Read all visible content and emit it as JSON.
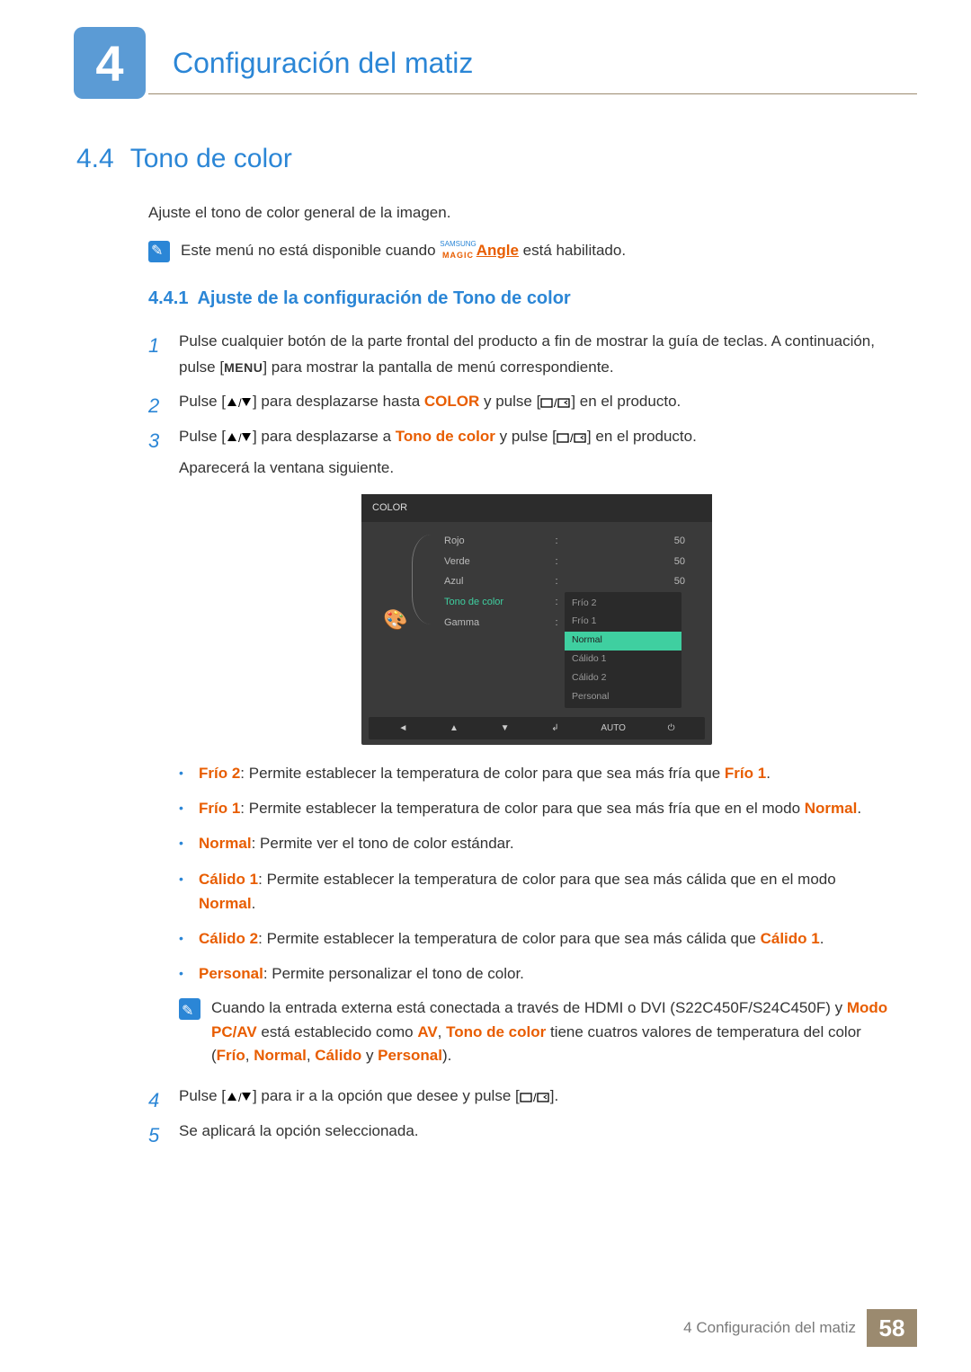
{
  "chapter": {
    "number": "4",
    "title": "Configuración del matiz"
  },
  "section": {
    "number": "4.4",
    "title": "Tono de color",
    "intro": "Ajuste el tono de color general de la imagen."
  },
  "note_top": {
    "pre": "Este menú no está disponible cuando ",
    "brand_top": "SAMSUNG",
    "brand_bottom": "MAGIC",
    "angle": "Angle",
    "post": " está habilitado."
  },
  "subsection": {
    "number": "4.4.1",
    "title": "Ajuste de la configuración de Tono de color"
  },
  "steps": {
    "s1a": "Pulse cualquier botón de la parte frontal del producto a fin de mostrar la guía de teclas. A continuación, pulse [",
    "s1_menu": "MENU",
    "s1b": "] para mostrar la pantalla de menú correspondiente.",
    "s2a": "Pulse [",
    "s2b": "] para desplazarse hasta ",
    "s2_color": "COLOR",
    "s2c": " y pulse [",
    "s2d": "] en el producto.",
    "s3a": "Pulse [",
    "s3b": "] para desplazarse a ",
    "s3_tone": "Tono de color",
    "s3c": " y pulse [",
    "s3d": "] en el producto.",
    "s3_after": "Aparecerá la ventana siguiente.",
    "s4a": "Pulse [",
    "s4b": "] para ir a la opción que desee y pulse [",
    "s4c": "].",
    "s5": "Se aplicará la opción seleccionada."
  },
  "osd": {
    "title": "COLOR",
    "rows": [
      {
        "label": "Rojo",
        "value": "50"
      },
      {
        "label": "Verde",
        "value": "50"
      },
      {
        "label": "Azul",
        "value": "50"
      },
      {
        "label": "Tono de color",
        "value": ""
      },
      {
        "label": "Gamma",
        "value": ""
      }
    ],
    "dropdown": [
      "Frío 2",
      "Frío 1",
      "Normal",
      "Cálido 1",
      "Cálido 2",
      "Personal"
    ],
    "selected": "Normal",
    "footer_auto": "AUTO"
  },
  "options": {
    "frio2_label": "Frío 2",
    "frio2_text": ": Permite establecer la temperatura de color para que sea más fría que ",
    "frio2_ref": "Frío 1",
    "frio1_label": "Frío 1",
    "frio1_text": ": Permite establecer la temperatura de color para que sea más fría que en el modo ",
    "frio1_ref": "Normal",
    "normal_label": "Normal",
    "normal_text": ": Permite ver el tono de color estándar.",
    "calido1_label": "Cálido 1",
    "calido1_text": ": Permite establecer la temperatura de color para que sea más cálida que en el modo ",
    "calido1_ref": "Normal",
    "calido2_label": "Cálido 2",
    "calido2_text": ": Permite establecer la temperatura de color para que sea más cálida que ",
    "calido2_ref": "Cálido 1",
    "personal_label": "Personal",
    "personal_text": ": Permite personalizar el tono de color."
  },
  "note_bottom": {
    "pre": "Cuando la entrada externa está conectada a través de HDMI o DVI (S22C450F/S24C450F) y ",
    "mode": "Modo PC/AV",
    "mid1": " está establecido como ",
    "av": "AV",
    "mid2": ", ",
    "tone": "Tono de color",
    "mid3": " tiene cuatros valores de temperatura del color (",
    "v1": "Frío",
    "c1": ", ",
    "v2": "Normal",
    "c2": ", ",
    "v3": "Cálido",
    "c3": " y ",
    "v4": "Personal",
    "end": ")."
  },
  "footer": {
    "text": "4 Configuración del matiz",
    "page": "58"
  }
}
